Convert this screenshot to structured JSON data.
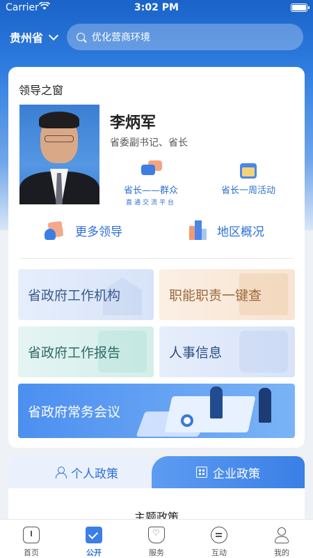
{
  "status_bar": {
    "carrier": "Carrier",
    "time": "3:02 PM"
  },
  "topbar": {
    "region": "贵州省",
    "search_placeholder": "优化营商环境"
  },
  "leader_section": {
    "title": "领导之窗",
    "name": "李炳军",
    "role": "省委副书记、省长",
    "actions": [
      {
        "label": "省长——群众",
        "sub": "直通交流平台",
        "icon": "chat-bubbles-icon"
      },
      {
        "label": "省长一周活动",
        "icon": "calendar-icon"
      }
    ],
    "links": [
      {
        "label": "更多领导",
        "icon": "more-leaders-icon"
      },
      {
        "label": "地区概况",
        "icon": "region-overview-icon"
      }
    ]
  },
  "tiles": [
    {
      "label": "省政府工作机构"
    },
    {
      "label": "职能职责一键查"
    },
    {
      "label": "省政府工作报告"
    },
    {
      "label": "人事信息"
    },
    {
      "label": "省政府常务会议"
    }
  ],
  "policy": {
    "tabs": [
      {
        "label": "个人政策",
        "icon": "person-icon"
      },
      {
        "label": "企业政策",
        "icon": "building-icon"
      }
    ],
    "section_title": "主题政策"
  },
  "bottom_nav": [
    {
      "label": "首页",
      "icon": "home-icon"
    },
    {
      "label": "公开",
      "icon": "public-icon",
      "active": true
    },
    {
      "label": "服务",
      "icon": "service-icon"
    },
    {
      "label": "互动",
      "icon": "interact-icon"
    },
    {
      "label": "我的",
      "icon": "mine-icon"
    }
  ],
  "colors": {
    "accent": "#2d6fd6",
    "header": "#1a63c8"
  }
}
